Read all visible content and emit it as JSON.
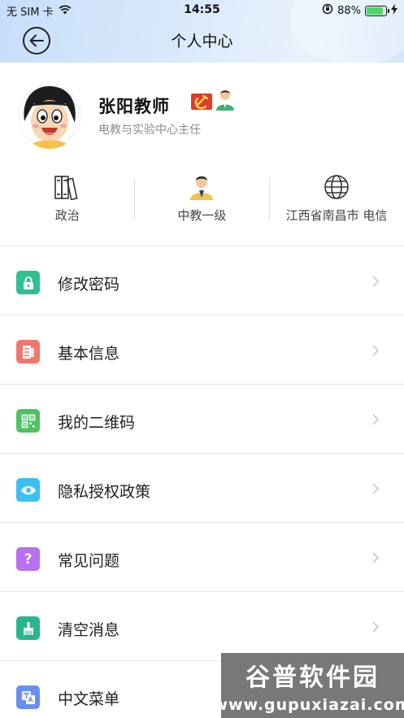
{
  "status_bar": {
    "carrier": "无 SIM 卡",
    "time": "14:55",
    "battery": "88%"
  },
  "header": {
    "title": "个人中心"
  },
  "profile": {
    "name": "张阳教师",
    "subtitle": "电教与实验中心主任"
  },
  "stats": [
    {
      "label": "政治",
      "icon": "books-icon"
    },
    {
      "label": "中教一级",
      "icon": "teacher-icon"
    },
    {
      "label": "江西省南昌市 电信",
      "icon": "globe-icon"
    }
  ],
  "menu": [
    {
      "label": "修改密码",
      "icon": "lock-icon",
      "color": "#2ec08e"
    },
    {
      "label": "基本信息",
      "icon": "document-icon",
      "color": "#f0776e"
    },
    {
      "label": "我的二维码",
      "icon": "qrcode-icon",
      "color": "#4fc265"
    },
    {
      "label": "隐私授权政策",
      "icon": "eye-icon",
      "color": "#3dbff0"
    },
    {
      "label": "常见问题",
      "icon": "question-icon",
      "color": "#b770f0"
    },
    {
      "label": "清空消息",
      "icon": "broom-icon",
      "color": "#2ab58f"
    },
    {
      "label": "中文菜单",
      "icon": "translate-icon",
      "color": "#6b8ff0"
    }
  ],
  "watermark": {
    "title": "谷普软件园",
    "url": "www.gupuxiazai.com"
  }
}
